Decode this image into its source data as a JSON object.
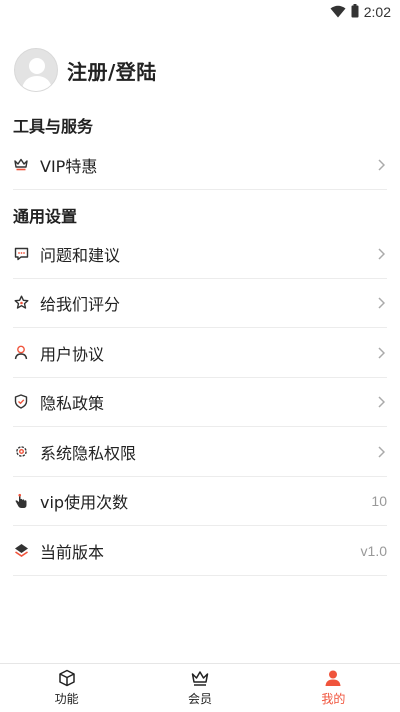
{
  "status": {
    "time": "2:02"
  },
  "profile": {
    "login_label": "注册/登陆"
  },
  "sections": {
    "tools": {
      "title": "工具与服务",
      "items": [
        {
          "label": "VIP特惠",
          "icon": "crown-icon"
        }
      ]
    },
    "settings": {
      "title": "通用设置",
      "items": [
        {
          "label": "问题和建议",
          "icon": "feedback-icon"
        },
        {
          "label": "给我们评分",
          "icon": "star-icon"
        },
        {
          "label": "用户协议",
          "icon": "user-icon"
        },
        {
          "label": "隐私政策",
          "icon": "shield-icon"
        },
        {
          "label": "系统隐私权限",
          "icon": "gear-icon"
        },
        {
          "label": "vip使用次数",
          "value": "10",
          "icon": "hand-icon"
        },
        {
          "label": "当前版本",
          "value": "v1.0",
          "icon": "layers-icon"
        }
      ]
    }
  },
  "nav": {
    "items": [
      {
        "label": "功能",
        "icon": "cube-icon"
      },
      {
        "label": "会员",
        "icon": "crown-icon"
      },
      {
        "label": "我的",
        "icon": "person-icon"
      }
    ],
    "active_color": "#f0543c"
  }
}
